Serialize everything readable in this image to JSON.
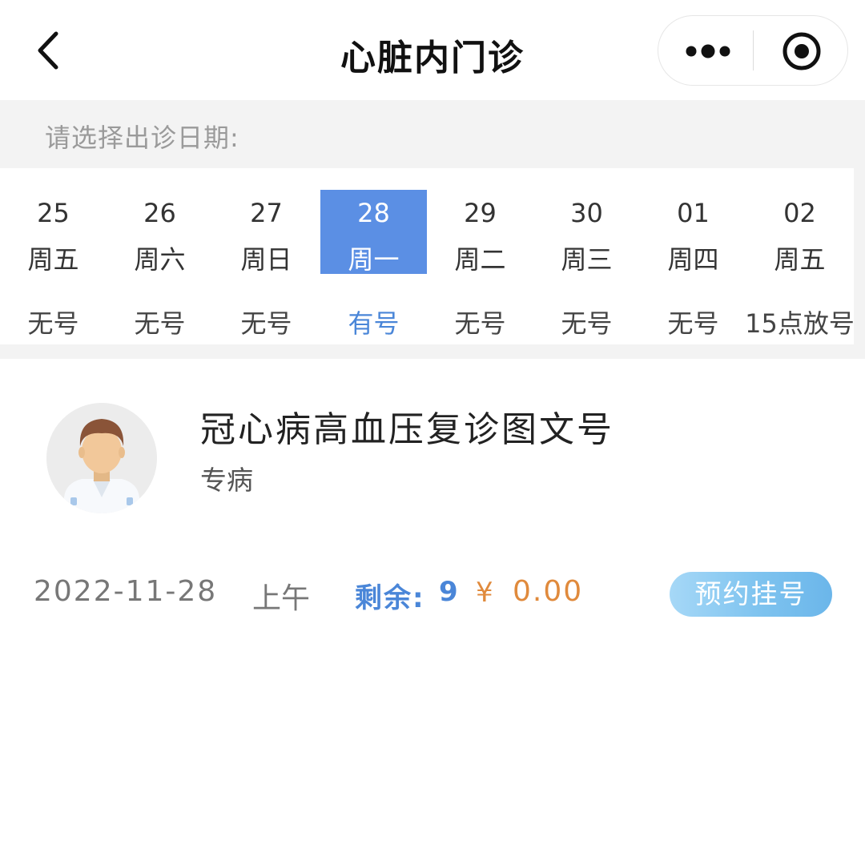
{
  "nav": {
    "title": "心脏内门诊",
    "back_icon": "chevron-left-icon",
    "more_icon": "more-dots-icon",
    "close_icon": "record-target-icon"
  },
  "date_picker": {
    "label": "请选择出诊日期:",
    "days": [
      {
        "date": "25",
        "weekday": "周五",
        "status": "无号",
        "selected": false
      },
      {
        "date": "26",
        "weekday": "周六",
        "status": "无号",
        "selected": false
      },
      {
        "date": "27",
        "weekday": "周日",
        "status": "无号",
        "selected": false
      },
      {
        "date": "28",
        "weekday": "周一",
        "status": "有号",
        "selected": true
      },
      {
        "date": "29",
        "weekday": "周二",
        "status": "无号",
        "selected": false
      },
      {
        "date": "30",
        "weekday": "周三",
        "status": "无号",
        "selected": false
      },
      {
        "date": "01",
        "weekday": "周四",
        "status": "无号",
        "selected": false
      },
      {
        "date": "02",
        "weekday": "周五",
        "status": "15点放号",
        "selected": false
      }
    ]
  },
  "doctor": {
    "title": "冠心病高血压复诊图文号",
    "subtitle": "专病",
    "avatar_icon": "doctor-avatar-icon"
  },
  "appointment": {
    "date": "2022-11-28",
    "period": "上午",
    "remaining_label": "剩余:",
    "remaining_count": "9",
    "currency": "¥",
    "price": "0.00",
    "book_label": "预约挂号"
  },
  "colors": {
    "accent": "#5b8fe4",
    "remaining": "#4a86d8",
    "price": "#e08a3c",
    "band": "#f3f3f3"
  }
}
